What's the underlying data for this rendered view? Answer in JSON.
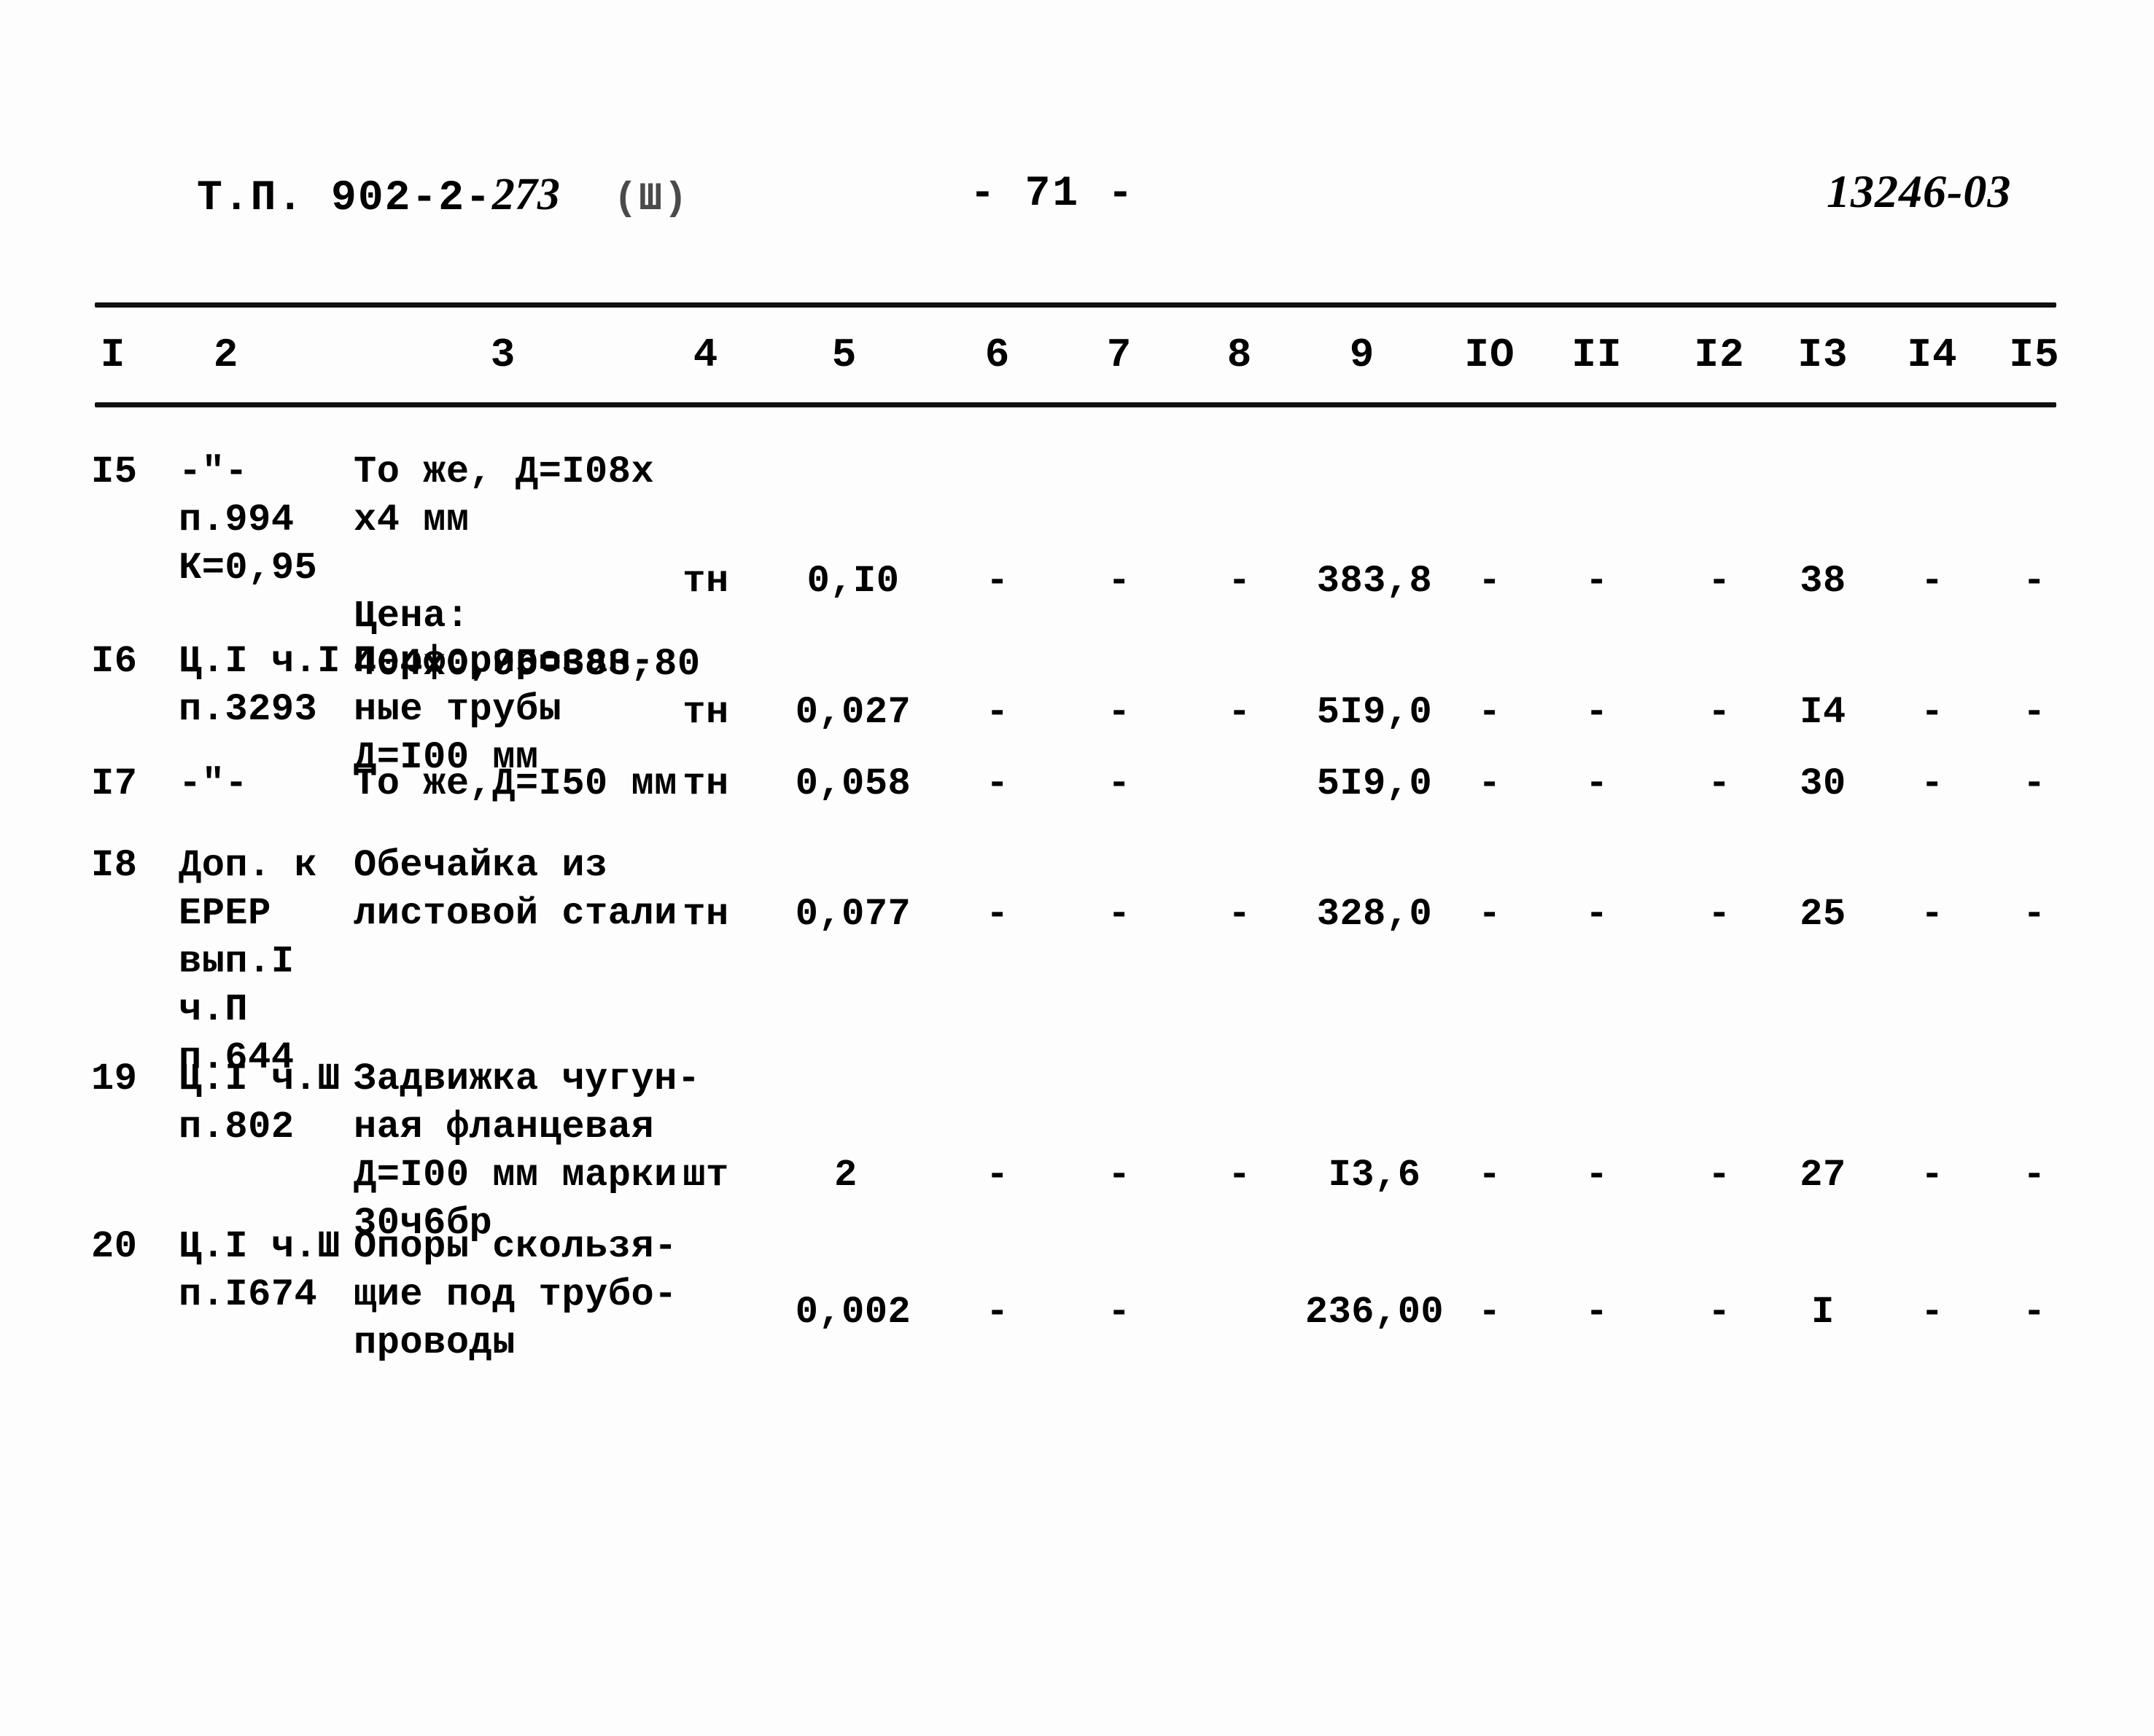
{
  "header": {
    "left_prefix": "Т.П. 902-2-",
    "left_handwritten": "273",
    "left_suffix": "(Ш)",
    "page_number": "- 71 -",
    "right_handwritten": "13246-03"
  },
  "table": {
    "column_headers": [
      "I",
      "2",
      "3",
      "4",
      "5",
      "6",
      "7",
      "8",
      "9",
      "IO",
      "II",
      "I2",
      "I3",
      "I4",
      "I5"
    ],
    "rows": [
      {
        "num": "I5",
        "source_lines": [
          "-\"-",
          "п.994",
          "К=0,95"
        ],
        "desc_lines": [
          "То же, Д=I08х",
          "х4 мм",
          "",
          "Цена:",
          "404х0,95=383,80"
        ],
        "unit": "тн",
        "c5": "0,I0",
        "c6": "-",
        "c7": "-",
        "c8": "-",
        "c9": "383,8",
        "c10": "-",
        "c11": "-",
        "c12": "-",
        "c13": "38",
        "c14": "-",
        "c15": "-"
      },
      {
        "num": "I6",
        "source_lines": [
          "Ц.I ч.I",
          "п.3293"
        ],
        "desc_lines": [
          "Перфорирован-",
          "ные трубы",
          "Д=I00 мм"
        ],
        "unit": "тн",
        "c5": "0,027",
        "c6": "-",
        "c7": "-",
        "c8": "-",
        "c9": "5I9,0",
        "c10": "-",
        "c11": "-",
        "c12": "-",
        "c13": "I4",
        "c14": "-",
        "c15": "-"
      },
      {
        "num": "I7",
        "source_lines": [
          "-\"-"
        ],
        "desc_lines": [
          "То же,Д=I50 мм"
        ],
        "unit": "тн",
        "c5": "0,058",
        "c6": "-",
        "c7": "-",
        "c8": "",
        "c9": "5I9,0",
        "c10": "-",
        "c11": "-",
        "c12": "-",
        "c13": "30",
        "c14": "-",
        "c15": "-"
      },
      {
        "num": "I8",
        "source_lines": [
          "Доп. к",
          "ЕРЕР",
          "вып.I",
          "ч.П",
          "п.644"
        ],
        "desc_lines": [
          "Обечайка из",
          "листовой стали"
        ],
        "unit": "тн",
        "c5": "0,077",
        "c6": "-",
        "c7": "-",
        "c8": "-",
        "c9": "328,0",
        "c10": "-",
        "c11": "-",
        "c12": "-",
        "c13": "25",
        "c14": "-",
        "c15": "-"
      },
      {
        "num": "19",
        "source_lines": [
          "Ц.I ч.Ш",
          "п.802"
        ],
        "desc_lines": [
          "Задвижка чугун-",
          "ная фланцевая",
          "Д=I00 мм марки",
          "30ч6бр"
        ],
        "unit": "шт",
        "c5": "2",
        "c6": "-",
        "c7": "-",
        "c8": "-",
        "c9": "I3,6",
        "c10": "-",
        "c11": "-",
        "c12": "-",
        "c13": "27",
        "c14": "-",
        "c15": "-"
      },
      {
        "num": "20",
        "source_lines": [
          "Ц.I ч.Ш",
          "п.I674"
        ],
        "desc_lines": [
          "Опоры скользя-",
          "щие под трубо-",
          "проводы"
        ],
        "unit": "",
        "c5": "0,002",
        "c6": "-",
        "c7": "-",
        "c8": "",
        "c9": "236,00",
        "c10": "-",
        "c11": "-",
        "c12": "-",
        "c13": "I",
        "c14": "-",
        "c15": "-"
      }
    ]
  }
}
